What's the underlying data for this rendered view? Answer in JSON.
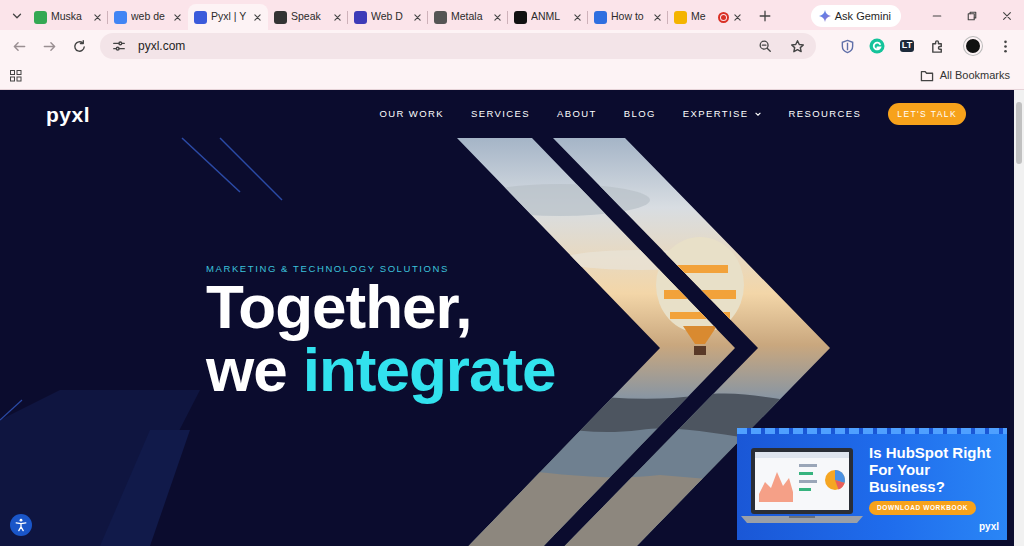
{
  "browser": {
    "tabs": [
      {
        "label": "Muska",
        "selected": false,
        "recording": false,
        "color": "#34a853"
      },
      {
        "label": "web de",
        "selected": false,
        "recording": false,
        "color": "#4285f4"
      },
      {
        "label": "Pyxl | Y",
        "selected": true,
        "recording": false,
        "color": "#3b5bdb"
      },
      {
        "label": "Speak",
        "selected": false,
        "recording": false,
        "color": "#333333"
      },
      {
        "label": "Web D",
        "selected": false,
        "recording": false,
        "color": "#3d3bb8"
      },
      {
        "label": "Metala",
        "selected": false,
        "recording": false,
        "color": "#555555"
      },
      {
        "label": "ANML",
        "selected": false,
        "recording": false,
        "color": "#111111"
      },
      {
        "label": "How to",
        "selected": false,
        "recording": false,
        "color": "#2f6fe0"
      },
      {
        "label": "Me",
        "selected": false,
        "recording": true,
        "color": "#f4b400"
      }
    ],
    "gemini": "Ask Gemini",
    "address": "pyxl.com",
    "extensions": [
      {
        "kind": "shield"
      },
      {
        "kind": "grammarly"
      },
      {
        "kind": "text",
        "label": "LT"
      },
      {
        "kind": "puzzle"
      }
    ],
    "bookmarks": {
      "all": "All Bookmarks"
    },
    "scrollbar": {
      "level": 0.14
    }
  },
  "site": {
    "logo": "pyxl",
    "nav": [
      {
        "label": "OUR WORK",
        "dropdown": false
      },
      {
        "label": "SERVICES",
        "dropdown": false
      },
      {
        "label": "ABOUT",
        "dropdown": false
      },
      {
        "label": "BLOG",
        "dropdown": false
      },
      {
        "label": "EXPERTISE",
        "dropdown": true
      },
      {
        "label": "RESOURCES",
        "dropdown": false
      }
    ],
    "cta": "LET'S TALK",
    "hero": {
      "eyebrow": "MARKETING & TECHNOLOGY SOLUTIONS",
      "line1": "Together,",
      "line2": [
        {
          "text": "we",
          "highlight": false
        },
        {
          "text": "integrate",
          "highlight": true
        }
      ]
    },
    "ad": {
      "title": "Is HubSpot Right For Your Business?",
      "button": "DOWNLOAD WORKBOOK",
      "logo": "pyxl"
    }
  }
}
